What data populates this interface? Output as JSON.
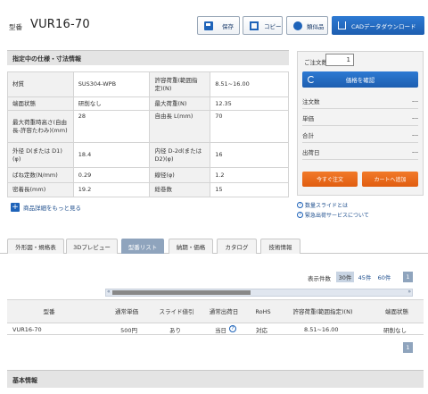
{
  "header": {
    "label": "型番",
    "model": "VUR16-70",
    "buttons": {
      "save": "保存",
      "copy": "コピー",
      "similar": "類似品",
      "cad": "CADデータダウンロード"
    }
  },
  "spec": {
    "title": "指定中の仕様・寸法情報",
    "rows": [
      [
        "材質",
        "SUS304-WPB",
        "許容荷重(範囲指定)(N)",
        "8.51~16.00"
      ],
      [
        "端面状態",
        "研削なし",
        "最大荷重(N)",
        "12.35"
      ],
      [
        "最大荷重時高さ(自由長-許容たわみ)(mm)",
        "28",
        "自由長 L(mm)",
        "70"
      ],
      [
        "外径 D(または D1)(φ)",
        "18.4",
        "内径 D-2d(または D2)(φ)",
        "16"
      ],
      [
        "ばね定数(N/mm)",
        "0.29",
        "線径(φ)",
        "1.2"
      ],
      [
        "密着長(mm)",
        "19.2",
        "総巻数",
        "15"
      ]
    ],
    "more_link": "商品詳細をもっと見る"
  },
  "order": {
    "qty_label": "ご注文数",
    "qty_value": "1",
    "price_button": "価格を確認",
    "rows": [
      {
        "label": "注文数",
        "value": "---"
      },
      {
        "label": "単価",
        "value": "---"
      },
      {
        "label": "合計",
        "value": "---"
      },
      {
        "label": "出荷日",
        "value": "---"
      }
    ],
    "order_now": "今すぐ注文",
    "add_cart": "カートへ追加",
    "link_slide": "数量スライドとは",
    "link_express": "緊急出荷サービスについて"
  },
  "tabs": [
    "外形図・規格表",
    "3Dプレビュー",
    "型番リスト",
    "納期・価格",
    "カタログ",
    "技術情報"
  ],
  "active_tab": 2,
  "list": {
    "display_label": "表示件数",
    "page_sizes": [
      "30件",
      "45件",
      "60件"
    ],
    "page": "1",
    "columns": [
      "型番",
      "通常単価",
      "スライド値引",
      "通常出荷日",
      "RoHS",
      "許容荷重(範囲指定)(N)",
      "端面状態"
    ],
    "row": {
      "model": "VUR16-70",
      "price": "500円",
      "slide": "あり",
      "ship": "当日",
      "rohs": "対応",
      "load": "8.51~16.00",
      "end": "研削なし"
    }
  },
  "basic_title": "基本情報",
  "colors": {
    "accent_blue": "#1e63b9",
    "order_orange": "#e8691a",
    "tab_active": "#8fa4bd"
  }
}
